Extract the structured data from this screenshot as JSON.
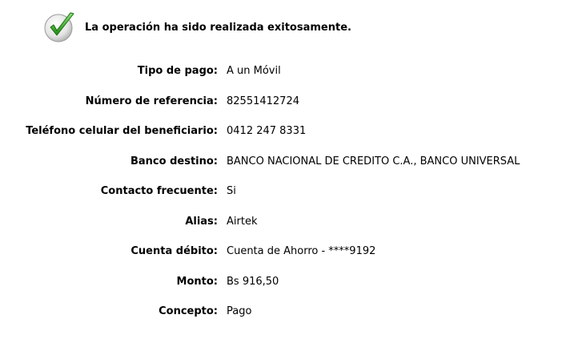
{
  "status": {
    "icon": "checkmark-icon",
    "message": "La operación ha sido realizada exitosamente.",
    "accent_color": "#2e9e1e"
  },
  "details": [
    {
      "label": "Tipo de pago:",
      "value": "A un Móvil"
    },
    {
      "label": "Número de referencia:",
      "value": "82551412724"
    },
    {
      "label": "Teléfono celular del beneficiario:",
      "value": "0412 247 8331"
    },
    {
      "label": "Banco destino:",
      "value": "BANCO NACIONAL DE CREDITO C.A., BANCO UNIVERSAL"
    },
    {
      "label": "Contacto frecuente:",
      "value": "Si"
    },
    {
      "label": "Alias:",
      "value": "Airtek"
    },
    {
      "label": "Cuenta débito:",
      "value": "Cuenta de Ahorro - ****9192"
    },
    {
      "label": "Monto:",
      "value": "Bs 916,50"
    },
    {
      "label": "Concepto:",
      "value": "Pago"
    }
  ]
}
